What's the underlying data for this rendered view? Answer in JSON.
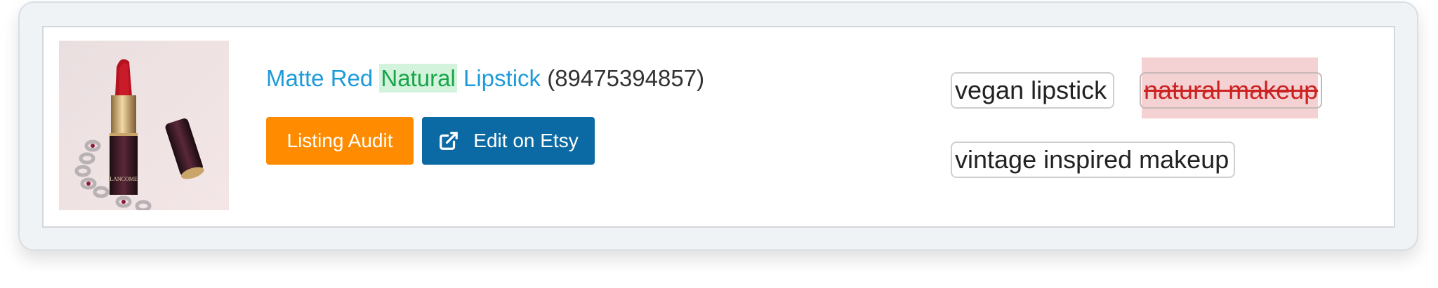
{
  "listing": {
    "title_before": "Matte Red",
    "title_highlight": "Natural",
    "title_after": "Lipstick",
    "listing_id": "(89475394857)"
  },
  "actions": {
    "audit_label": "Listing Audit",
    "etsy_label": "Edit on Etsy",
    "etsy_icon": "external-link-icon"
  },
  "tags": [
    {
      "label": "vegan lipstick",
      "status": "normal"
    },
    {
      "label": "natural makeup",
      "status": "removed"
    },
    {
      "label": "vintage inspired makeup",
      "status": "normal"
    }
  ],
  "colors": {
    "audit_button": "#ff8c00",
    "etsy_button": "#0b69a3",
    "title_link": "#1d9bd9",
    "highlight_text": "#19a54a",
    "highlight_bg": "#d3f3dc",
    "removed_tag_bg": "#f4d2d3",
    "removed_tag_text": "#cc2222"
  },
  "thumbnail": {
    "image_label": "LANCOME"
  }
}
